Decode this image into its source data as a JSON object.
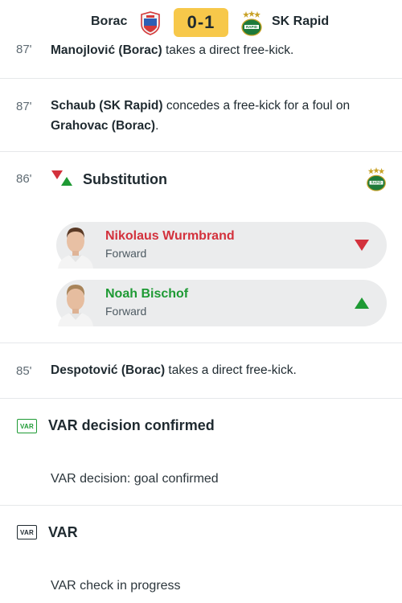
{
  "header": {
    "home_team": "Borac",
    "away_team": "SK Rapid",
    "score": "0-1"
  },
  "events": [
    {
      "minute": "87'",
      "player": "Manojlović (Borac)",
      "text_after": " takes a direct free-kick."
    },
    {
      "minute": "87'",
      "player": "Schaub (SK Rapid)",
      "text_mid": " concedes a free-kick for a foul on ",
      "player2": "Grahovac (Borac)",
      "text_after": "."
    },
    {
      "minute": "86'",
      "title": "Substitution",
      "out": {
        "name": "Nikolaus Wurmbrand",
        "role": "Forward"
      },
      "in": {
        "name": "Noah Bischof",
        "role": "Forward"
      }
    },
    {
      "minute": "85'",
      "player": "Despotović (Borac)",
      "text_after": " takes a direct free-kick."
    }
  ],
  "var_events": [
    {
      "badge": "VAR",
      "title": "VAR decision confirmed",
      "description": "VAR decision: goal confirmed"
    },
    {
      "badge": "VAR",
      "title": "VAR",
      "description": "VAR check in progress"
    }
  ],
  "colors": {
    "score_bg": "#f7c84a",
    "out_red": "#d3313c",
    "in_green": "#1e9a34",
    "var_green": "#1e9a34",
    "var_dark": "#1f2a30"
  },
  "icons": {
    "home_crest": "borac-crest-icon",
    "away_crest": "rapid-crest-icon",
    "substitution": "substitution-icon",
    "arrow_down": "arrow-down-icon",
    "arrow_up": "arrow-up-icon",
    "var": "var-icon"
  }
}
